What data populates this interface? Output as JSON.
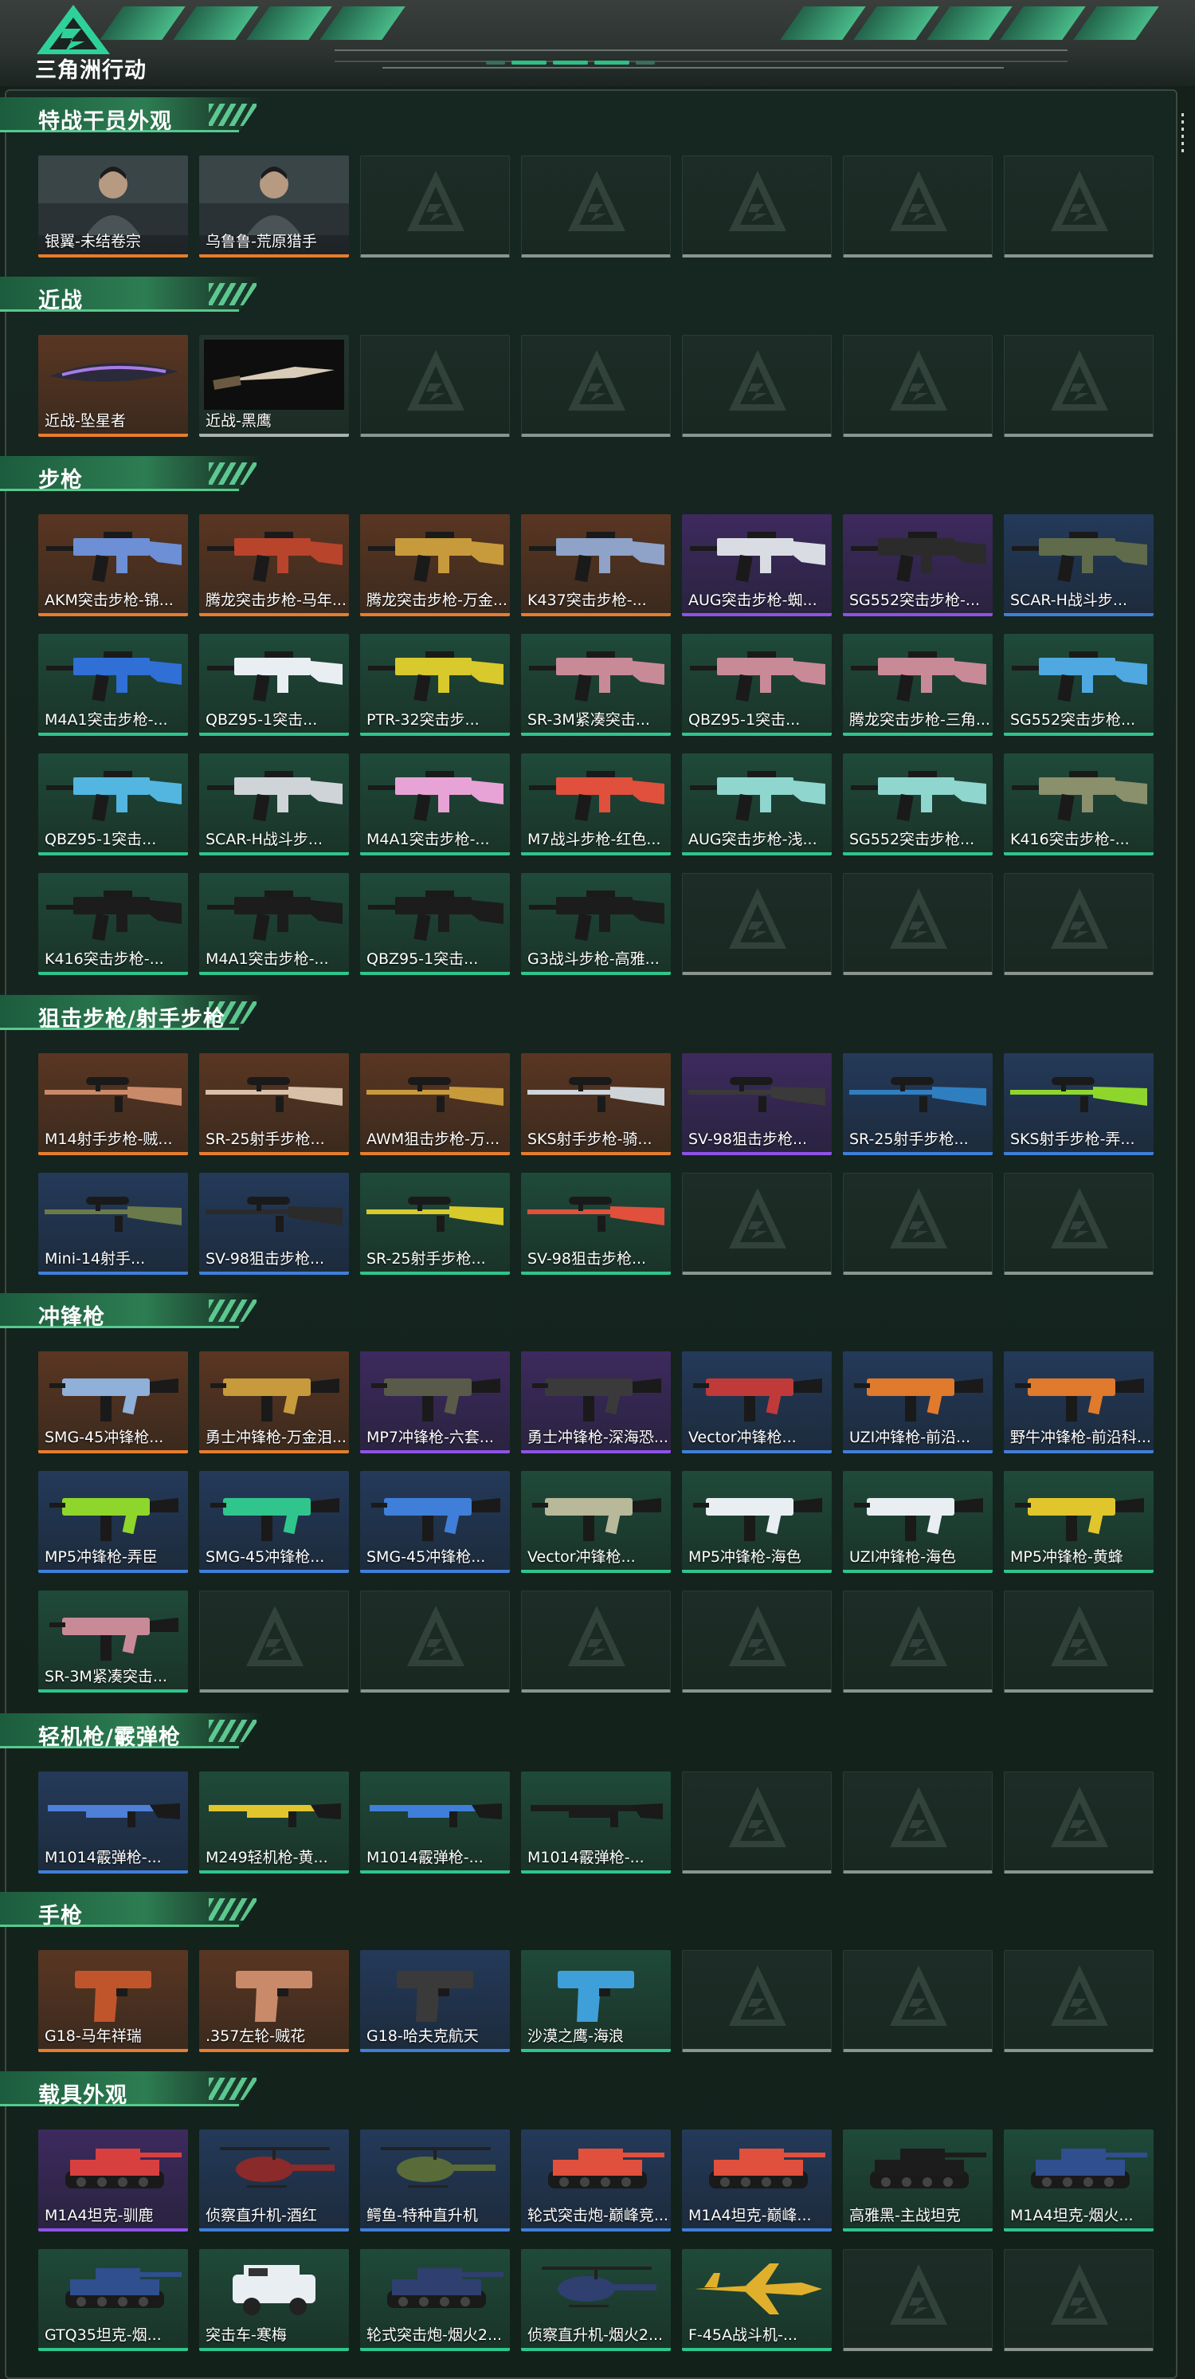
{
  "header": {
    "logo_text": "三角洲行动",
    "logo_icon": "delta-triangle-logo"
  },
  "colors": {
    "gold": "#e77d2e",
    "purple": "#8e52e6",
    "blue": "#3f7fd9",
    "green": "#2fc58d",
    "empty": "#8a9590",
    "accent": "#56c98d"
  },
  "sections": [
    {
      "title": "特战干员外观",
      "items": [
        {
          "label": "银翼-未结卷宗",
          "rarity": "gold",
          "kind": "portrait"
        },
        {
          "label": "乌鲁鲁-荒原猎手",
          "rarity": "gold",
          "kind": "portrait"
        },
        {
          "empty": true
        },
        {
          "empty": true
        },
        {
          "empty": true
        },
        {
          "empty": true
        },
        {
          "empty": true
        }
      ]
    },
    {
      "title": "近战",
      "items": [
        {
          "label": "近战-坠星者",
          "rarity": "gold",
          "kind": "blade"
        },
        {
          "label": "近战-黑鹰",
          "rarity": "gray",
          "kind": "knife"
        },
        {
          "empty": true
        },
        {
          "empty": true
        },
        {
          "empty": true
        },
        {
          "empty": true
        },
        {
          "empty": true
        }
      ]
    },
    {
      "title": "步枪",
      "items": [
        {
          "label": "AKM突击步枪-锦...",
          "rarity": "gold",
          "kind": "rifle",
          "tint": "#6c8fd6"
        },
        {
          "label": "腾龙突击步枪-马年...",
          "rarity": "gold",
          "kind": "rifle",
          "tint": "#b8442c"
        },
        {
          "label": "腾龙突击步枪-万金...",
          "rarity": "gold",
          "kind": "rifle",
          "tint": "#c79a3c"
        },
        {
          "label": "K437突击步枪-...",
          "rarity": "gold",
          "kind": "rifle",
          "tint": "#8fa2c8"
        },
        {
          "label": "AUG突击步枪-蜘...",
          "rarity": "purple",
          "kind": "rifle",
          "tint": "#d9dde3"
        },
        {
          "label": "SG552突击步枪-...",
          "rarity": "purple",
          "kind": "rifle",
          "tint": "#2b2b2b"
        },
        {
          "label": "SCAR-H战斗步...",
          "rarity": "blue",
          "kind": "rifle",
          "tint": "#5f6b4a"
        },
        {
          "label": "M4A1突击步枪-...",
          "rarity": "green",
          "kind": "rifle",
          "tint": "#2f6fd6"
        },
        {
          "label": "QBZ95-1突击...",
          "rarity": "green",
          "kind": "rifle",
          "tint": "#e9eef2"
        },
        {
          "label": "PTR-32突击步...",
          "rarity": "green",
          "kind": "rifle",
          "tint": "#d8c92c"
        },
        {
          "label": "SR-3M紧凑突击...",
          "rarity": "green",
          "kind": "rifle",
          "tint": "#c98a98"
        },
        {
          "label": "QBZ95-1突击...",
          "rarity": "green",
          "kind": "rifle",
          "tint": "#c98a98"
        },
        {
          "label": "腾龙突击步枪-三角...",
          "rarity": "green",
          "kind": "rifle",
          "tint": "#c98a98"
        },
        {
          "label": "SG552突击步枪...",
          "rarity": "green",
          "kind": "rifle",
          "tint": "#4fa8e0"
        },
        {
          "label": "QBZ95-1突击...",
          "rarity": "green",
          "kind": "rifle",
          "tint": "#53b6e0"
        },
        {
          "label": "SCAR-H战斗步...",
          "rarity": "green",
          "kind": "rifle",
          "tint": "#cfd4d8"
        },
        {
          "label": "M4A1突击步枪-...",
          "rarity": "green",
          "kind": "rifle",
          "tint": "#e7a3d6"
        },
        {
          "label": "M7战斗步枪-红色...",
          "rarity": "green",
          "kind": "rifle",
          "tint": "#e0503c"
        },
        {
          "label": "AUG突击步枪-浅...",
          "rarity": "green",
          "kind": "rifle",
          "tint": "#8fd6cf"
        },
        {
          "label": "SG552突击步枪...",
          "rarity": "green",
          "kind": "rifle",
          "tint": "#8fd6cf"
        },
        {
          "label": "K416突击步枪-...",
          "rarity": "green",
          "kind": "rifle",
          "tint": "#8a8f6c"
        },
        {
          "label": "K416突击步枪-...",
          "rarity": "green",
          "kind": "rifle",
          "tint": "#1c1c1c"
        },
        {
          "label": "M4A1突击步枪-...",
          "rarity": "green",
          "kind": "rifle",
          "tint": "#1c1c1c"
        },
        {
          "label": "QBZ95-1突击...",
          "rarity": "green",
          "kind": "rifle",
          "tint": "#1c1c1c"
        },
        {
          "label": "G3战斗步枪-高雅...",
          "rarity": "green",
          "kind": "rifle",
          "tint": "#1c1c1c"
        },
        {
          "empty": true
        },
        {
          "empty": true
        },
        {
          "empty": true
        }
      ]
    },
    {
      "title": "狙击步枪/射手步枪",
      "items": [
        {
          "label": "M14射手步枪-贼...",
          "rarity": "gold",
          "kind": "sniper",
          "tint": "#c98a6a"
        },
        {
          "label": "SR-25射手步枪...",
          "rarity": "gold",
          "kind": "sniper",
          "tint": "#d8c0a8"
        },
        {
          "label": "AWM狙击步枪-万...",
          "rarity": "gold",
          "kind": "sniper",
          "tint": "#c79a3c"
        },
        {
          "label": "SKS射手步枪-骑...",
          "rarity": "gold",
          "kind": "sniper",
          "tint": "#cfd4d8"
        },
        {
          "label": "SV-98狙击步枪...",
          "rarity": "purple",
          "kind": "sniper",
          "tint": "#3a3a3a"
        },
        {
          "label": "SR-25射手步枪...",
          "rarity": "blue",
          "kind": "sniper",
          "tint": "#2f7fc0"
        },
        {
          "label": "SKS射手步枪-弄...",
          "rarity": "blue",
          "kind": "sniper",
          "tint": "#8fd62c"
        },
        {
          "label": "Mini-14射手...",
          "rarity": "blue",
          "kind": "sniper",
          "tint": "#6b7a4a"
        },
        {
          "label": "SV-98狙击步枪...",
          "rarity": "blue",
          "kind": "sniper",
          "tint": "#2b2b2b"
        },
        {
          "label": "SR-25射手步枪...",
          "rarity": "green",
          "kind": "sniper",
          "tint": "#d8c92c"
        },
        {
          "label": "SV-98狙击步枪...",
          "rarity": "green",
          "kind": "sniper",
          "tint": "#e0503c"
        },
        {
          "empty": true
        },
        {
          "empty": true
        },
        {
          "empty": true
        }
      ]
    },
    {
      "title": "冲锋枪",
      "items": [
        {
          "label": "SMG-45冲锋枪...",
          "rarity": "gold",
          "kind": "smg",
          "tint": "#8fb0d8"
        },
        {
          "label": "勇士冲锋枪-万金泪...",
          "rarity": "gold",
          "kind": "smg",
          "tint": "#c79a3c"
        },
        {
          "label": "MP7冲锋枪-六套...",
          "rarity": "purple",
          "kind": "smg",
          "tint": "#5a5a4a"
        },
        {
          "label": "勇士冲锋枪-深海恐...",
          "rarity": "purple",
          "kind": "smg",
          "tint": "#3a3a3a"
        },
        {
          "label": "Vector冲锋枪...",
          "rarity": "blue",
          "kind": "smg",
          "tint": "#c03a3a"
        },
        {
          "label": "UZI冲锋枪-前沿...",
          "rarity": "blue",
          "kind": "smg",
          "tint": "#e07a2c"
        },
        {
          "label": "野牛冲锋枪-前沿科...",
          "rarity": "blue",
          "kind": "smg",
          "tint": "#e07a2c"
        },
        {
          "label": "MP5冲锋枪-弄臣",
          "rarity": "blue",
          "kind": "smg",
          "tint": "#8fd62c"
        },
        {
          "label": "SMG-45冲锋枪...",
          "rarity": "blue",
          "kind": "smg",
          "tint": "#2fc58d"
        },
        {
          "label": "SMG-45冲锋枪...",
          "rarity": "blue",
          "kind": "smg",
          "tint": "#3f7fd9"
        },
        {
          "label": "Vector冲锋枪...",
          "rarity": "green",
          "kind": "smg",
          "tint": "#b8b89a"
        },
        {
          "label": "MP5冲锋枪-海色",
          "rarity": "green",
          "kind": "smg",
          "tint": "#e9eef2"
        },
        {
          "label": "UZI冲锋枪-海色",
          "rarity": "green",
          "kind": "smg",
          "tint": "#e9eef2"
        },
        {
          "label": "MP5冲锋枪-黄蜂",
          "rarity": "green",
          "kind": "smg",
          "tint": "#e0c52c"
        },
        {
          "label": "SR-3M紧凑突击...",
          "rarity": "green",
          "kind": "smg",
          "tint": "#c98a98"
        },
        {
          "empty": true
        },
        {
          "empty": true
        },
        {
          "empty": true
        },
        {
          "empty": true
        },
        {
          "empty": true
        },
        {
          "empty": true
        }
      ]
    },
    {
      "title": "轻机枪/霰弹枪",
      "items": [
        {
          "label": "M1014霰弹枪-...",
          "rarity": "blue",
          "kind": "shotgun",
          "tint": "#4f7fd6"
        },
        {
          "label": "M249轻机枪-黄...",
          "rarity": "green",
          "kind": "shotgun",
          "tint": "#e0c52c"
        },
        {
          "label": "M1014霰弹枪-...",
          "rarity": "green",
          "kind": "shotgun",
          "tint": "#3f7fd9"
        },
        {
          "label": "M1014霰弹枪-...",
          "rarity": "green",
          "kind": "shotgun",
          "tint": "#1c1c1c"
        },
        {
          "empty": true
        },
        {
          "empty": true
        },
        {
          "empty": true
        }
      ]
    },
    {
      "title": "手枪",
      "items": [
        {
          "label": "G18-马年祥瑞",
          "rarity": "gold",
          "kind": "pistol",
          "tint": "#c0552c"
        },
        {
          "label": ".357左轮-贼花",
          "rarity": "gold",
          "kind": "pistol",
          "tint": "#c98a6a"
        },
        {
          "label": "G18-哈夫克航天",
          "rarity": "blue",
          "kind": "pistol",
          "tint": "#3a3a3a"
        },
        {
          "label": "沙漠之鹰-海浪",
          "rarity": "green",
          "kind": "pistol",
          "tint": "#3f9fd9"
        },
        {
          "empty": true
        },
        {
          "empty": true
        },
        {
          "empty": true
        }
      ]
    },
    {
      "title": "载具外观",
      "items": [
        {
          "label": "M1A4坦克-驯鹿",
          "rarity": "purple",
          "kind": "tank",
          "tint": "#d84040"
        },
        {
          "label": "侦察直升机-酒红",
          "rarity": "blue",
          "kind": "heli",
          "tint": "#8a2a2a"
        },
        {
          "label": "鳄鱼-特种直升机",
          "rarity": "blue",
          "kind": "heli",
          "tint": "#5a6b3a"
        },
        {
          "label": "轮式突击炮-巅峰竞...",
          "rarity": "blue",
          "kind": "tank",
          "tint": "#e0503c"
        },
        {
          "label": "M1A4坦克-巅峰...",
          "rarity": "blue",
          "kind": "tank",
          "tint": "#e0503c"
        },
        {
          "label": "高雅黑-主战坦克",
          "rarity": "green",
          "kind": "tank",
          "tint": "#1c1c1c"
        },
        {
          "label": "M1A4坦克-烟火...",
          "rarity": "green",
          "kind": "tank",
          "tint": "#2f4f8f"
        },
        {
          "label": "GTQ35坦克-烟...",
          "rarity": "green",
          "kind": "tank",
          "tint": "#2f4f8f"
        },
        {
          "label": "突击车-寒梅",
          "rarity": "green",
          "kind": "jeep",
          "tint": "#e9eef2"
        },
        {
          "label": "轮式突击炮-烟火2...",
          "rarity": "green",
          "kind": "tank",
          "tint": "#2f3f6f"
        },
        {
          "label": "侦察直升机-烟火2...",
          "rarity": "green",
          "kind": "heli",
          "tint": "#2f3f6f"
        },
        {
          "label": "F-45A战斗机-...",
          "rarity": "green",
          "kind": "jet",
          "tint": "#e0b02c"
        },
        {
          "empty": true
        },
        {
          "empty": true
        }
      ]
    }
  ]
}
